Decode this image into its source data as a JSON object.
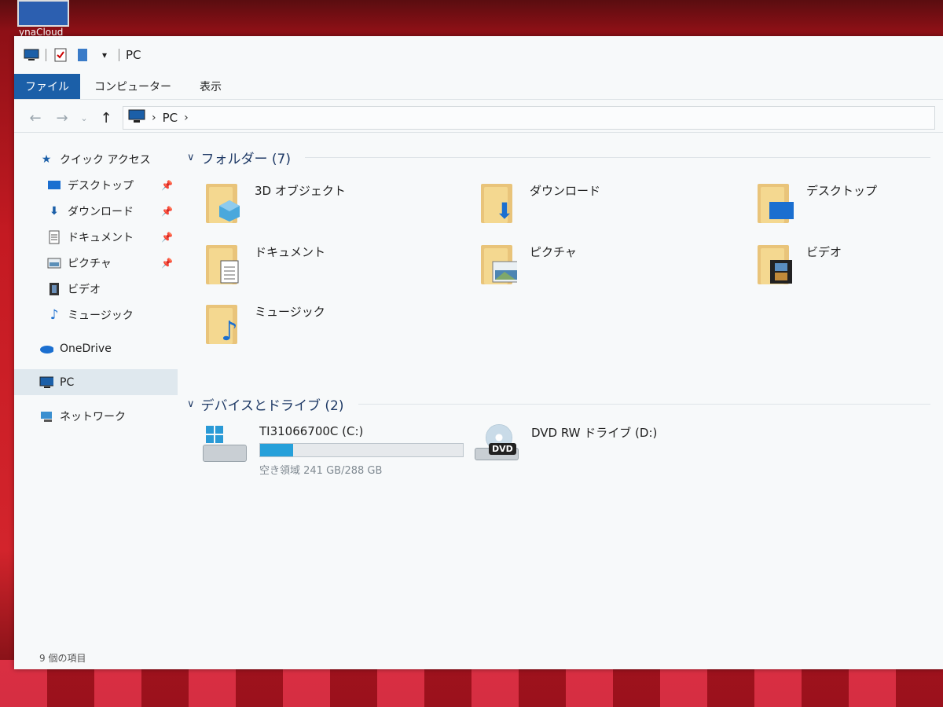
{
  "desktop": {
    "shortcut_label": "ynaCloud"
  },
  "titlebar": {
    "title": "PC"
  },
  "ribbon": {
    "tabs": [
      "ファイル",
      "コンピューター",
      "表示"
    ]
  },
  "address": {
    "crumb": "PC"
  },
  "sidebar": {
    "quick_access": "クイック アクセス",
    "items": [
      {
        "label": "デスクトップ",
        "pinned": true
      },
      {
        "label": "ダウンロード",
        "pinned": true
      },
      {
        "label": "ドキュメント",
        "pinned": true
      },
      {
        "label": "ピクチャ",
        "pinned": true
      },
      {
        "label": "ビデオ",
        "pinned": false
      },
      {
        "label": "ミュージック",
        "pinned": false
      }
    ],
    "onedrive": "OneDrive",
    "pc": "PC",
    "network": "ネットワーク"
  },
  "groups": {
    "folders_header": "フォルダー (7)",
    "drives_header": "デバイスとドライブ (2)"
  },
  "folders": [
    {
      "label": "3D オブジェクト",
      "icon": "cube-icon"
    },
    {
      "label": "ダウンロード",
      "icon": "download-arrow-icon"
    },
    {
      "label": "デスクトップ",
      "icon": "desktop-icon"
    },
    {
      "label": "ドキュメント",
      "icon": "document-icon"
    },
    {
      "label": "ピクチャ",
      "icon": "picture-icon"
    },
    {
      "label": "ビデオ",
      "icon": "film-icon"
    },
    {
      "label": "ミュージック",
      "icon": "music-note-icon"
    }
  ],
  "drives": [
    {
      "name": "TI31066700C (C:)",
      "free": "空き領域 241 GB/288 GB",
      "used_fraction": 0.163
    },
    {
      "name": "DVD RW ドライブ (D:)"
    }
  ],
  "status": {
    "item_count": "9 個の項目"
  },
  "colors": {
    "accent": "#1b5fa8",
    "drive_fill": "#26a0da",
    "desktop": "#c41a22"
  }
}
